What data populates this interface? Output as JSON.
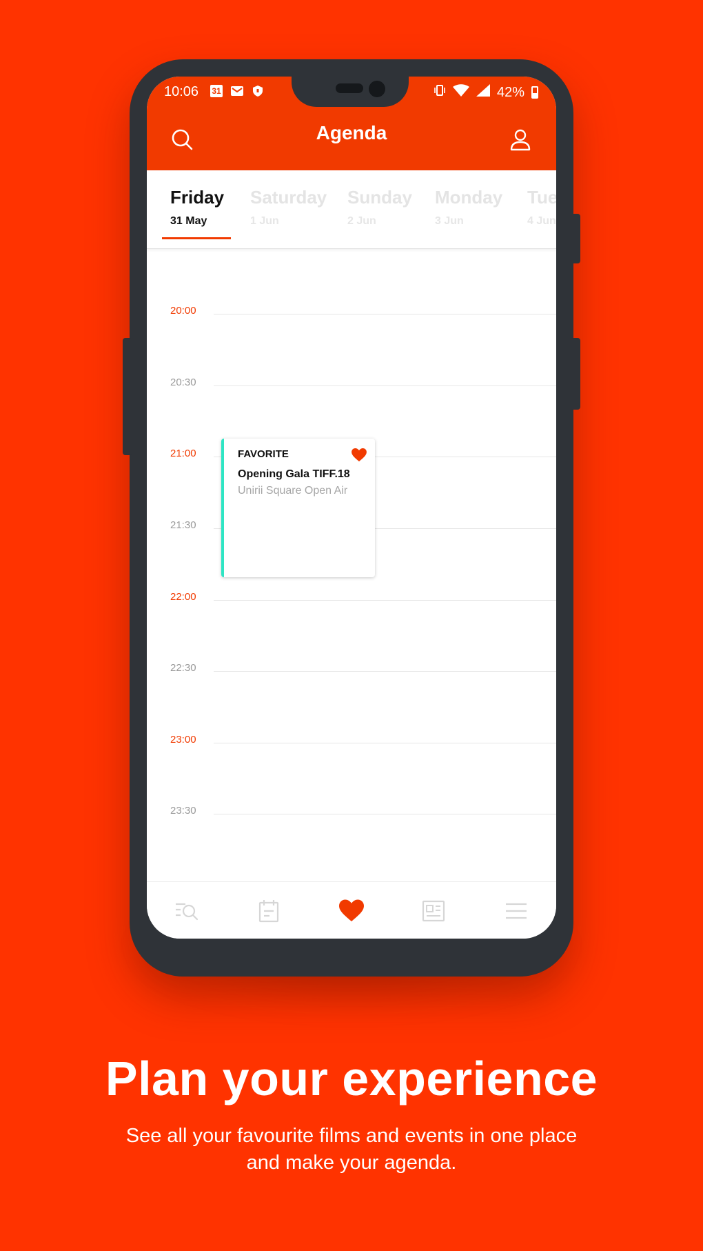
{
  "status_bar": {
    "time": "10:06",
    "calendar_badge": "31",
    "battery": "42%"
  },
  "app_bar": {
    "title": "Agenda"
  },
  "day_tabs": [
    {
      "day": "Friday",
      "date": "31 May"
    },
    {
      "day": "Saturday",
      "date": "1 Jun"
    },
    {
      "day": "Sunday",
      "date": "2 Jun"
    },
    {
      "day": "Monday",
      "date": "3 Jun"
    },
    {
      "day": "Tue",
      "date": "4 Jun"
    }
  ],
  "timeline": {
    "slots": [
      "20:00",
      "20:30",
      "21:00",
      "21:30",
      "22:00",
      "22:30",
      "23:00",
      "23:30"
    ]
  },
  "event": {
    "category": "FAVORITE",
    "title": "Opening Gala TIFF.18",
    "venue": "Unirii Square Open Air",
    "accent_color": "#2ee5c4"
  },
  "bottom_nav": [
    "search-list-icon",
    "calendar-icon",
    "heart-icon",
    "news-icon",
    "menu-icon"
  ],
  "promo": {
    "headline": "Plan your experience",
    "description": "See all your favourite films and events in one place and make your agenda."
  },
  "colors": {
    "brand": "#ff3300",
    "app_bar": "#f13a00",
    "phone": "#2f3338"
  }
}
